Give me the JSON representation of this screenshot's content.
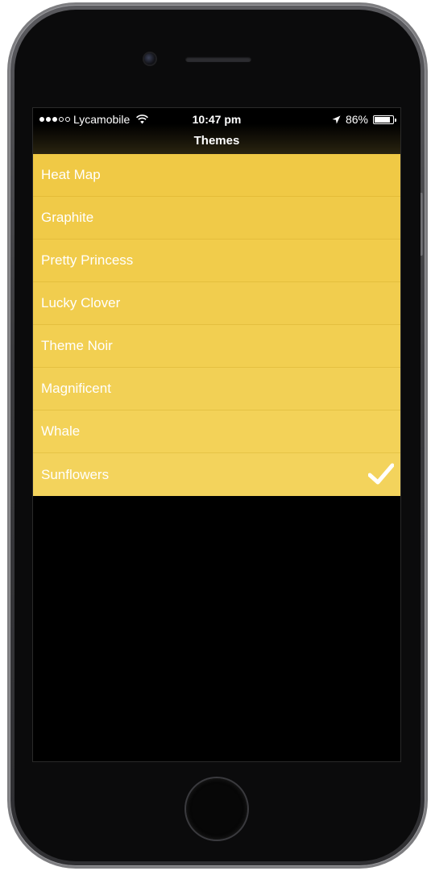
{
  "status_bar": {
    "carrier": "Lycamobile",
    "signal_bars_filled": 3,
    "signal_bars_total": 5,
    "time": "10:47 pm",
    "battery_percent": "86%",
    "battery_level": 0.86
  },
  "nav": {
    "title": "Themes"
  },
  "themes": [
    {
      "label": "Heat Map",
      "selected": false
    },
    {
      "label": "Graphite",
      "selected": false
    },
    {
      "label": "Pretty Princess",
      "selected": false
    },
    {
      "label": "Lucky Clover",
      "selected": false
    },
    {
      "label": "Theme Noir",
      "selected": false
    },
    {
      "label": "Magnificent",
      "selected": false
    },
    {
      "label": "Whale",
      "selected": false
    },
    {
      "label": "Sunflowers",
      "selected": true
    }
  ],
  "icons": {
    "wifi": "wifi-icon",
    "location": "location-arrow-icon",
    "battery": "battery-icon",
    "checkmark": "checkmark-icon"
  },
  "colors": {
    "row_yellow": "#f1cd4e",
    "text": "#ffffff",
    "background": "#000000"
  }
}
